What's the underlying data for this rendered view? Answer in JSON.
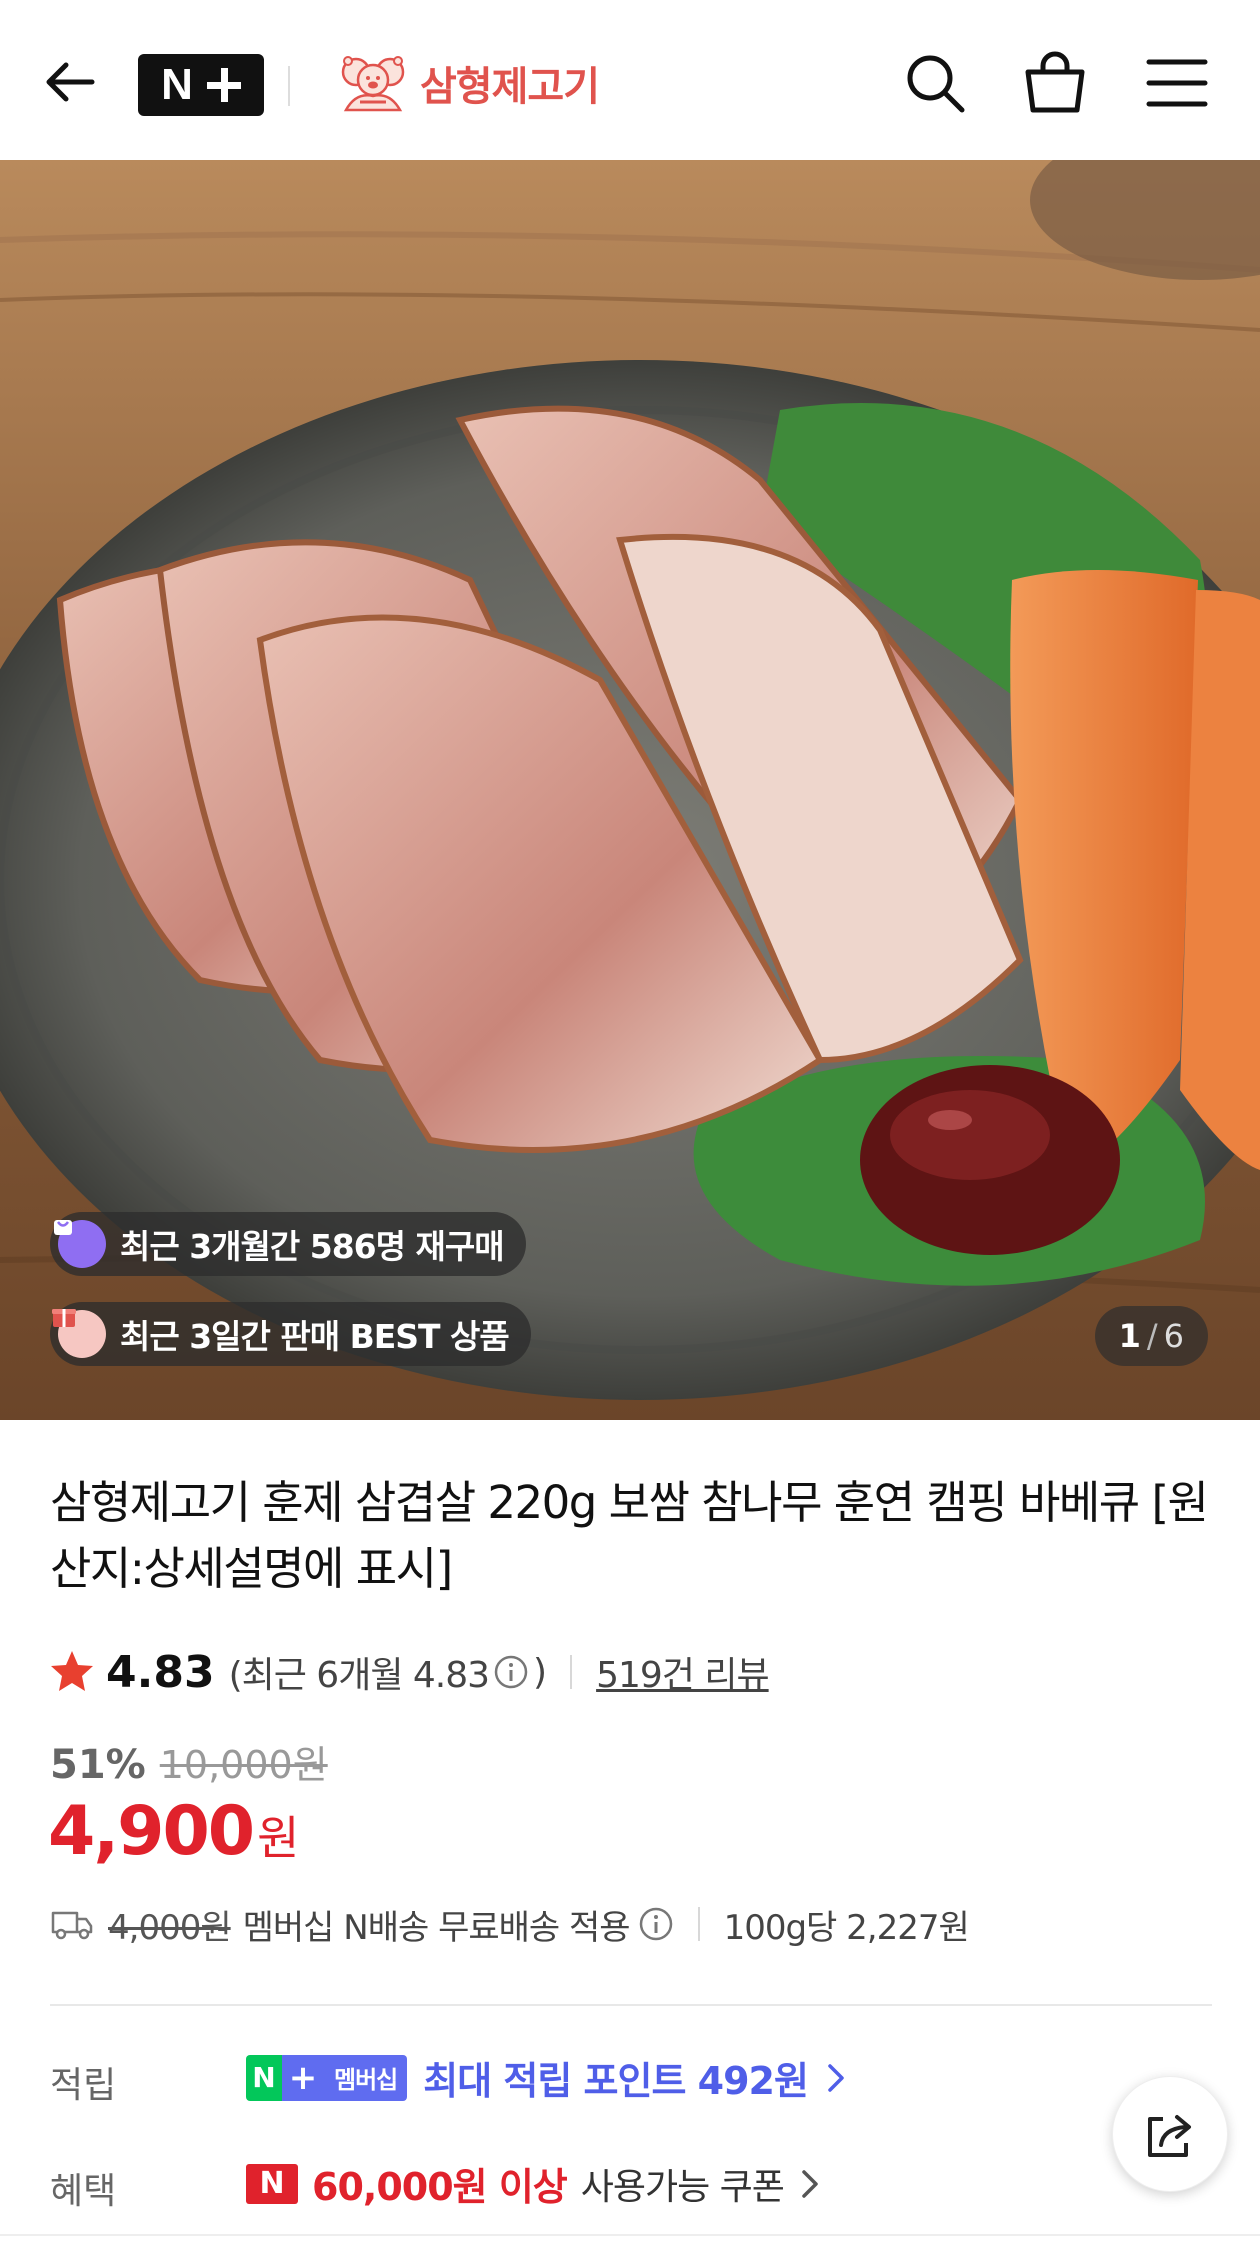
{
  "header": {
    "logo_text": "N",
    "brand_name": "삼형제고기"
  },
  "gallery": {
    "repurchase_badge": "최근 3개월간 586명 재구매",
    "best_badge": "최근 3일간 판매 BEST 상품",
    "current_page": "1",
    "separator": "/",
    "total_pages": "6"
  },
  "product": {
    "title": "삼형제고기 훈제 삼겹살 220g 보쌈 참나무 훈연 캠핑 바베큐 [원산지:상세설명에 표시]",
    "rating": "4.83",
    "rating_recent_prefix": "(최근 6개월 4.83",
    "rating_recent_suffix": ")",
    "review_count": "519건 리뷰",
    "discount_rate": "51%",
    "original_price": "10,000원",
    "sale_price": "4,900",
    "price_unit": "원"
  },
  "delivery": {
    "original_fee": "4,000원",
    "text": "멤버십 N배송 무료배송 적용",
    "unit_price": "100g당 2,227원"
  },
  "points": {
    "label": "적립",
    "badge_n": "N",
    "badge_plus": "+",
    "badge_text": "멤버십",
    "text": "최대 적립 포인트 492원"
  },
  "benefit": {
    "label": "혜택",
    "badge": "N",
    "amount": "60,000원 이상",
    "text": "사용가능 쿠폰"
  },
  "colors": {
    "accent_red": "#e0222c",
    "brand_red": "#e0534d",
    "membership_blue": "#4f5ee8",
    "naver_green": "#03c75a"
  }
}
